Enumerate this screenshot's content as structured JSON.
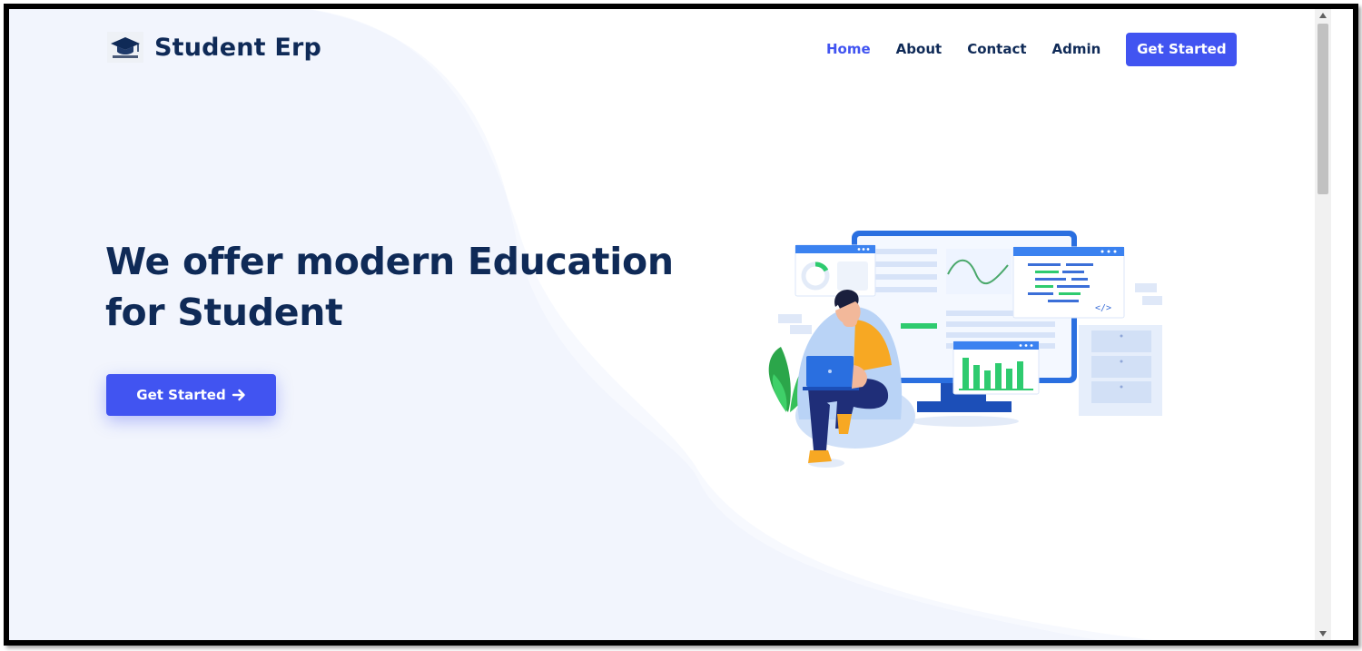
{
  "brand": {
    "name": "Student Erp",
    "icon": "graduation-cap-icon"
  },
  "nav": {
    "items": [
      {
        "label": "Home",
        "active": true
      },
      {
        "label": "About",
        "active": false
      },
      {
        "label": "Contact",
        "active": false
      },
      {
        "label": "Admin",
        "active": false
      }
    ],
    "cta_label": "Get Started"
  },
  "hero": {
    "title_line1": "We offer modern Education",
    "title_line2": "for Student",
    "button_label": "Get Started",
    "button_icon": "arrow-right-icon",
    "illustration": "student-with-laptop-illustration"
  },
  "colors": {
    "accent": "#4154f1",
    "heading": "#0f2a57",
    "hero_bg": "#f2f5fd"
  }
}
